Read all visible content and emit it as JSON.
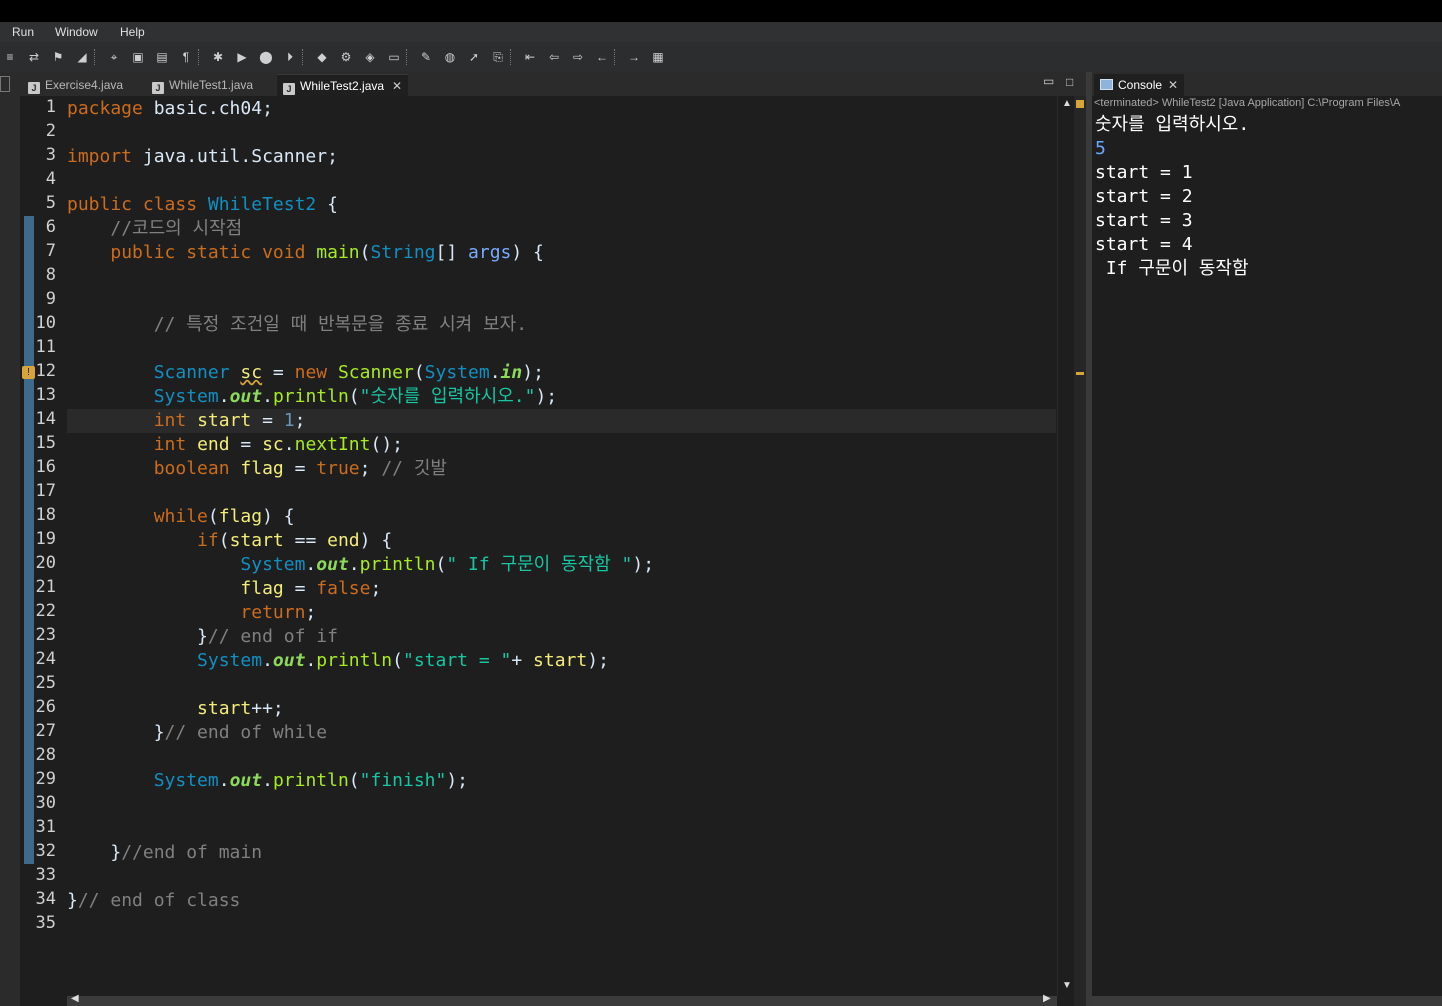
{
  "menubar": {
    "items": [
      "Run",
      "Window",
      "Help"
    ]
  },
  "toolbar": {
    "icons": [
      "new-wizard-icon",
      "save-icon",
      "build-icon",
      "pen-icon",
      "annotation-icon",
      "task-icon",
      "toggle-icon",
      "pilcrow-icon",
      "debug-icon",
      "run-icon",
      "coverage-icon",
      "external-tools-icon",
      "new-class-icon",
      "search-icon",
      "open-type-icon",
      "open-folder-icon",
      "pencil-icon",
      "globe-icon",
      "launch-icon",
      "bookmark-icon",
      "next-annotation-icon",
      "back-icon",
      "forward-icon",
      "left-arrow-icon",
      "right-arrow-icon",
      "perspective-icon"
    ]
  },
  "editor": {
    "tabs": [
      {
        "label": "Exercise4.java",
        "active": false
      },
      {
        "label": "WhileTest1.java",
        "active": false
      },
      {
        "label": "WhileTest2.java",
        "active": true
      }
    ],
    "line_numbers": [
      "1",
      "2",
      "3",
      "4",
      "5",
      "6",
      "7",
      "8",
      "9",
      "10",
      "11",
      "12",
      "13",
      "14",
      "15",
      "16",
      "17",
      "18",
      "19",
      "20",
      "21",
      "22",
      "23",
      "24",
      "25",
      "26",
      "27",
      "28",
      "29",
      "30",
      "31",
      "32",
      "33",
      "34",
      "35"
    ],
    "lines": [
      [
        [
          "kw",
          "package "
        ],
        [
          "pl",
          "basic.ch04;"
        ]
      ],
      [],
      [
        [
          "kw",
          "import "
        ],
        [
          "pl",
          "java.util.Scanner;"
        ]
      ],
      [],
      [
        [
          "kw",
          "public class "
        ],
        [
          "cs",
          "WhileTest2"
        ],
        [
          "pl",
          " {"
        ]
      ],
      [
        [
          "pl",
          "    "
        ],
        [
          "cm",
          "//코드의 시작점"
        ]
      ],
      [
        [
          "pl",
          "    "
        ],
        [
          "kw",
          "public static void "
        ],
        [
          "me",
          "main"
        ],
        [
          "pl",
          "("
        ],
        [
          "cs",
          "String"
        ],
        [
          "pl",
          "[] "
        ],
        [
          "pa",
          "args"
        ],
        [
          "pl",
          ") {"
        ]
      ],
      [],
      [],
      [
        [
          "pl",
          "        "
        ],
        [
          "cm",
          "// 특정 조건일 때 반복문을 종료 시켜 보자."
        ]
      ],
      [],
      [
        [
          "pl",
          "        "
        ],
        [
          "cs",
          "Scanner "
        ],
        [
          "va",
          "sc"
        ],
        [
          "pl",
          " = "
        ],
        [
          "kw",
          "new "
        ],
        [
          "me",
          "Scanner"
        ],
        [
          "pl",
          "("
        ],
        [
          "cs",
          "System"
        ],
        [
          "pl",
          "."
        ],
        [
          "fi",
          "in"
        ],
        [
          "pl",
          ");"
        ]
      ],
      [
        [
          "pl",
          "        "
        ],
        [
          "cs",
          "System"
        ],
        [
          "pl",
          "."
        ],
        [
          "fi",
          "out"
        ],
        [
          "pl",
          "."
        ],
        [
          "me",
          "println"
        ],
        [
          "pl",
          "("
        ],
        [
          "st",
          "\"숫자를 입력하시오.\""
        ],
        [
          "pl",
          ");"
        ]
      ],
      [
        [
          "pl",
          "        "
        ],
        [
          "kw",
          "int "
        ],
        [
          "va",
          "start"
        ],
        [
          "pl",
          " = "
        ],
        [
          "nu",
          "1"
        ],
        [
          "pl",
          ";"
        ]
      ],
      [
        [
          "pl",
          "        "
        ],
        [
          "kw",
          "int "
        ],
        [
          "va",
          "end"
        ],
        [
          "pl",
          " = "
        ],
        [
          "va",
          "sc"
        ],
        [
          "pl",
          "."
        ],
        [
          "me",
          "nextInt"
        ],
        [
          "pl",
          "();"
        ]
      ],
      [
        [
          "pl",
          "        "
        ],
        [
          "kw",
          "boolean "
        ],
        [
          "va",
          "flag"
        ],
        [
          "pl",
          " = "
        ],
        [
          "kw",
          "true"
        ],
        [
          "pl",
          "; "
        ],
        [
          "cm",
          "// 깃발"
        ]
      ],
      [],
      [
        [
          "pl",
          "        "
        ],
        [
          "kw",
          "while"
        ],
        [
          "pl",
          "("
        ],
        [
          "va",
          "flag"
        ],
        [
          "pl",
          ") {"
        ]
      ],
      [
        [
          "pl",
          "            "
        ],
        [
          "kw",
          "if"
        ],
        [
          "pl",
          "("
        ],
        [
          "va",
          "start"
        ],
        [
          "pl",
          " == "
        ],
        [
          "va",
          "end"
        ],
        [
          "pl",
          ") {"
        ]
      ],
      [
        [
          "pl",
          "                "
        ],
        [
          "cs",
          "System"
        ],
        [
          "pl",
          "."
        ],
        [
          "fi",
          "out"
        ],
        [
          "pl",
          "."
        ],
        [
          "me",
          "println"
        ],
        [
          "pl",
          "("
        ],
        [
          "st",
          "\" If 구문이 동작함 \""
        ],
        [
          "pl",
          ");"
        ]
      ],
      [
        [
          "pl",
          "                "
        ],
        [
          "va",
          "flag"
        ],
        [
          "pl",
          " = "
        ],
        [
          "kw",
          "false"
        ],
        [
          "pl",
          ";"
        ]
      ],
      [
        [
          "pl",
          "                "
        ],
        [
          "kw",
          "return"
        ],
        [
          "pl",
          ";"
        ]
      ],
      [
        [
          "pl",
          "            }"
        ],
        [
          "cm",
          "// end of if"
        ]
      ],
      [
        [
          "pl",
          "            "
        ],
        [
          "cs",
          "System"
        ],
        [
          "pl",
          "."
        ],
        [
          "fi",
          "out"
        ],
        [
          "pl",
          "."
        ],
        [
          "me",
          "println"
        ],
        [
          "pl",
          "("
        ],
        [
          "st",
          "\"start = \""
        ],
        [
          "pl",
          "+ "
        ],
        [
          "va",
          "start"
        ],
        [
          "pl",
          ");"
        ]
      ],
      [],
      [
        [
          "pl",
          "            "
        ],
        [
          "va",
          "start"
        ],
        [
          "pl",
          "++;"
        ]
      ],
      [
        [
          "pl",
          "        }"
        ],
        [
          "cm",
          "// end of while"
        ]
      ],
      [],
      [
        [
          "pl",
          "        "
        ],
        [
          "cs",
          "System"
        ],
        [
          "pl",
          "."
        ],
        [
          "fi",
          "out"
        ],
        [
          "pl",
          "."
        ],
        [
          "me",
          "println"
        ],
        [
          "pl",
          "("
        ],
        [
          "st",
          "\"finish\""
        ],
        [
          "pl",
          ");"
        ]
      ],
      [],
      [],
      [
        [
          "pl",
          "    }"
        ],
        [
          "cm",
          "//end of main"
        ]
      ],
      [],
      [
        [
          "pl",
          "}"
        ],
        [
          "cm",
          "// end of class"
        ]
      ],
      []
    ],
    "current_line": 14
  },
  "console": {
    "tab_label": "Console",
    "status": "<terminated> WhileTest2 [Java Application] C:\\Program Files\\A",
    "output": [
      {
        "text": "숫자를 입력하시오.",
        "color": "#ffffff"
      },
      {
        "text": "5",
        "color": "#6aa7ff"
      },
      {
        "text": "start = 1",
        "color": "#ffffff"
      },
      {
        "text": "start = 2",
        "color": "#ffffff"
      },
      {
        "text": "start = 3",
        "color": "#ffffff"
      },
      {
        "text": "start = 4",
        "color": "#ffffff"
      },
      {
        "text": " If 구문이 동작함 ",
        "color": "#ffffff"
      }
    ]
  },
  "colors": {
    "background": "#1e1e1e",
    "keyword": "#cc6c1d",
    "type": "#1290c3",
    "comment": "#808080",
    "string": "#17c6a3",
    "method": "#a7ec21",
    "variable": "#f3ec79",
    "number": "#6897bb",
    "static_field": "#8dda5b"
  }
}
